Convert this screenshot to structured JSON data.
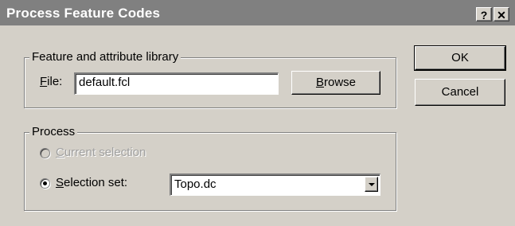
{
  "window": {
    "title": "Process Feature Codes",
    "help_label": "?",
    "close_label": "✕"
  },
  "library_group": {
    "legend": "Feature and attribute library",
    "file_label_accel": "F",
    "file_label_rest": "ile:",
    "file_value": "default.fcl",
    "browse_accel": "B",
    "browse_rest": "rowse"
  },
  "process_group": {
    "legend": "Process",
    "current_accel": "C",
    "current_rest": "urrent selection",
    "current_selected": false,
    "current_enabled": false,
    "set_accel": "S",
    "set_rest": "election set:",
    "set_selected": true,
    "set_value": "Topo.dc"
  },
  "buttons": {
    "ok": "OK",
    "cancel": "Cancel"
  }
}
